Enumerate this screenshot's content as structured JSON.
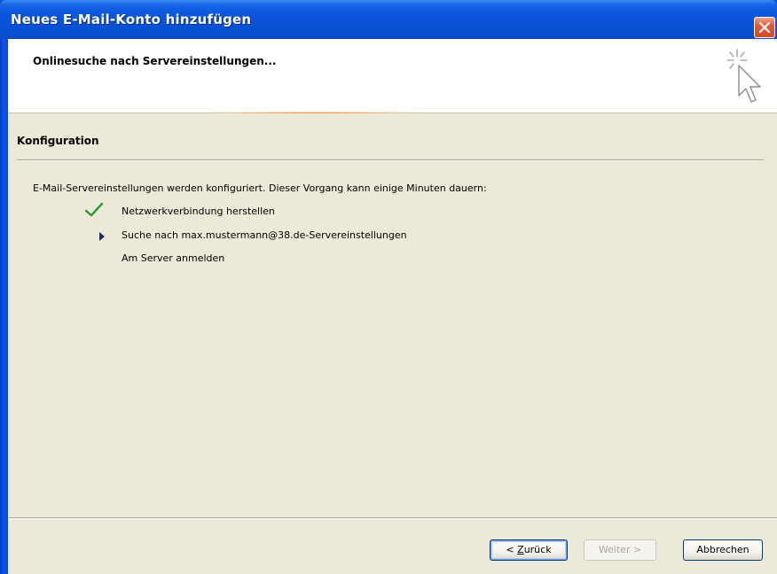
{
  "window": {
    "title": "Neues E-Mail-Konto hinzufügen",
    "close_icon": "close-x-icon"
  },
  "header": {
    "title": "Onlinesuche nach Servereinstellungen...",
    "icon": "cursor-sparkle-icon"
  },
  "section": {
    "title": "Konfiguration"
  },
  "intro_text": "E-Mail-Servereinstellungen werden konfiguriert. Dieser Vorgang kann einige Minuten dauern:",
  "steps": [
    {
      "label": "Netzwerkverbindung herstellen",
      "status": "done",
      "icon": "checkmark-icon"
    },
    {
      "label": "Suche nach max.mustermann@38.de-Servereinstellungen",
      "status": "current",
      "icon": "arrow-right-icon"
    },
    {
      "label": "Am Server anmelden",
      "status": "pending",
      "icon": ""
    }
  ],
  "buttons": {
    "back_prefix": "< ",
    "back_accel": "Z",
    "back_rest": "urück",
    "next_label": "Weiter >",
    "cancel_label": "Abbrechen"
  },
  "colors": {
    "titlebar": "#0a55dc",
    "dialog_bg": "#ece9d8",
    "check_green": "#2c9a2c",
    "progress_orange": "#f07a1c"
  }
}
